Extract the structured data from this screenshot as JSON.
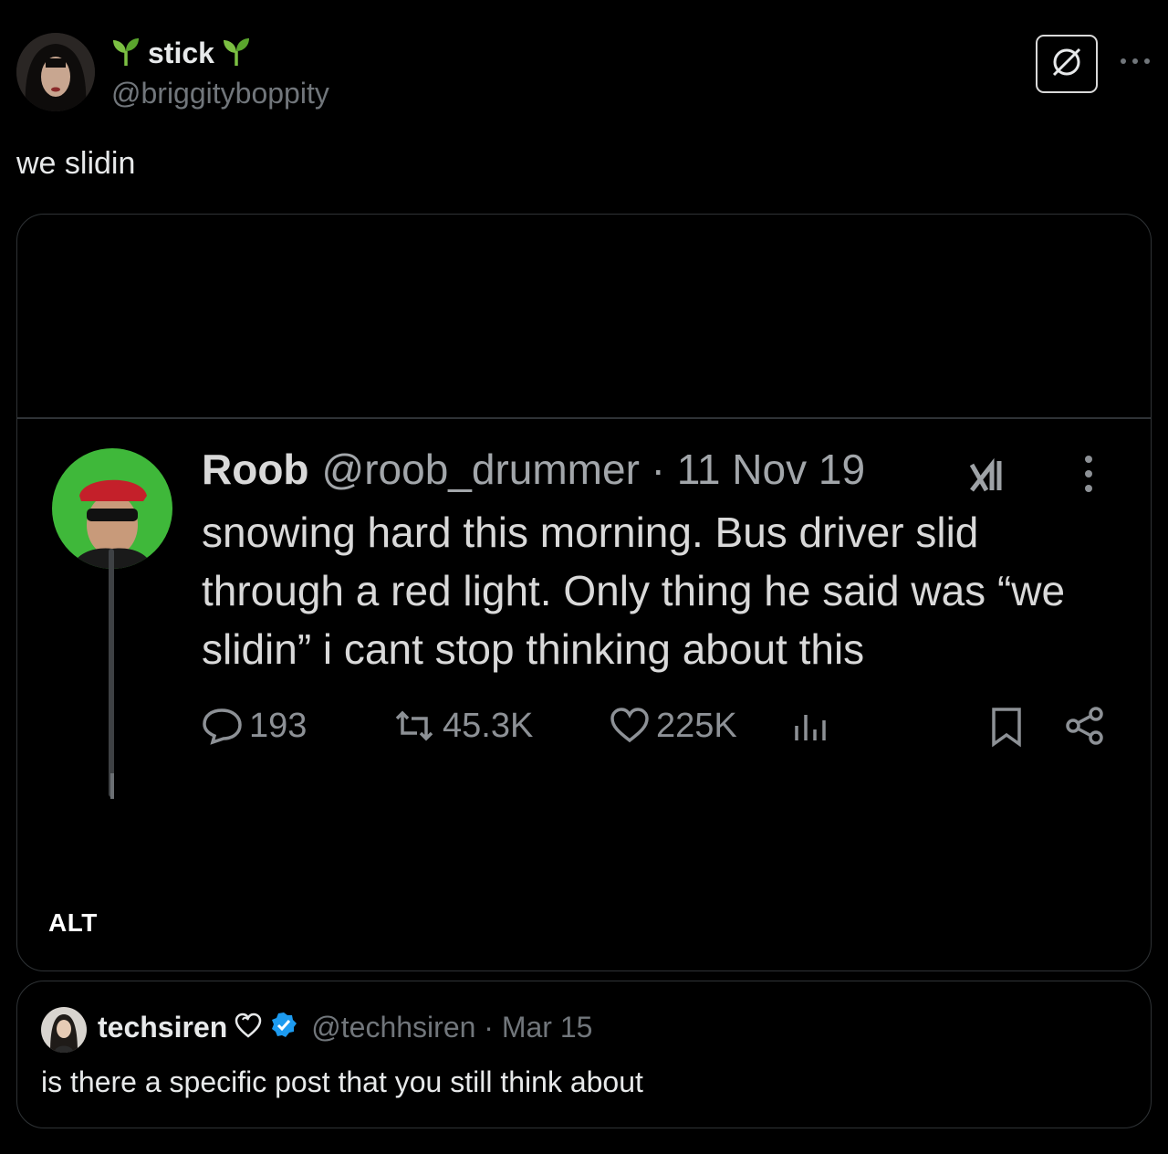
{
  "post": {
    "display_name": "stick",
    "name_emoji_icon": "seedling-icon",
    "handle": "@briggityboppity",
    "text": "we slidin",
    "grok_icon": "grok-icon",
    "more_icon": "more-horizontal-icon"
  },
  "media": {
    "alt_label": "ALT",
    "screenshot": {
      "name": "Roob",
      "handle_date": "@roob_drummer · 11 Nov 19",
      "text": "snowing hard this morning. Bus driver slid through a red light. Only thing he said was “we slidin” i cant stop thinking about this",
      "replies": "193",
      "reposts": "45.3K",
      "likes": "225K",
      "icons": [
        "reply-icon",
        "repost-icon",
        "like-icon",
        "views-icon",
        "bookmark-icon",
        "share-icon",
        "x-logo-icon",
        "more-vertical-icon"
      ]
    }
  },
  "quote": {
    "display_name": "techsiren",
    "badge_icon": "verified-badge-icon",
    "heart_icon": "heart-emoji-icon",
    "handle_date": "@techhsiren · Mar 15",
    "text": "is there a specific post that you still think about"
  },
  "colors": {
    "background": "#000000",
    "text": "#e7e9ea",
    "secondary": "#71767b",
    "border": "#2f3336",
    "verified": "#1d9bf0",
    "seedling": "#7cc043"
  }
}
